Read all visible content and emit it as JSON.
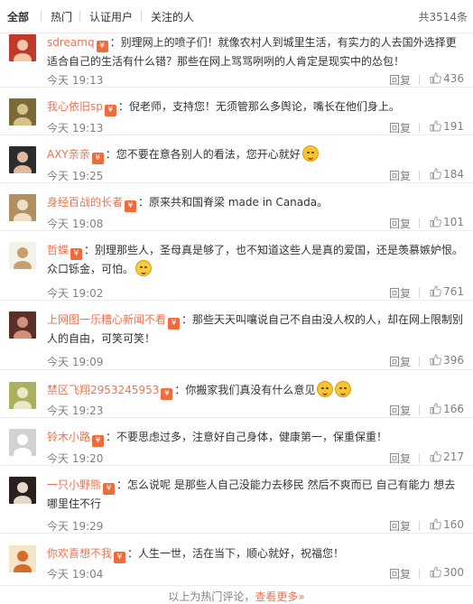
{
  "tabs": [
    "全部",
    "热门",
    "认证用户",
    "关注的人"
  ],
  "total": "共3514条",
  "vip_label": "¥",
  "reply_label": "回复",
  "colors": {
    "name": "#eb7350",
    "vip": "#f06a3a",
    "muted": "#808080"
  },
  "comments": [
    {
      "user": "sdreamq",
      "text": "：别理网上的喷子们！就像农村人到城里生活，有实力的人去国外选择更适合自己的生活有什么错？那些在网上骂骂咧咧的人肯定是现实中的怂包！",
      "time": "今天 19:13",
      "likes": "436",
      "emoji": 0
    },
    {
      "user": "我心依旧sp",
      "text": "：倪老师，支持您！无须管那么多舆论，嘴长在他们身上。",
      "time": "今天 19:13",
      "likes": "191",
      "emoji": 0
    },
    {
      "user": "AXY亲亲",
      "text": "：您不要在意各别人的看法，您开心就好",
      "time": "今天 19:25",
      "likes": "184",
      "emoji": 1
    },
    {
      "user": "身经百战的长者",
      "text": "：原来共和国脊梁 made in Canada。",
      "time": "今天 19:08",
      "likes": "101",
      "emoji": 0
    },
    {
      "user": "哲蝶",
      "text": "：别理那些人，圣母真是够了，也不知道这些人是真的爱国，还是羡慕嫉妒恨。众口铄金，可怕。",
      "time": "今天 19:02",
      "likes": "761",
      "emoji": 1
    },
    {
      "user": "上网图一乐糟心新闻不看",
      "text": "：那些天天叫嚷说自己不自由没人权的人，却在网上限制别人的自由，可笑可笑！",
      "time": "今天 19:09",
      "likes": "396",
      "emoji": 0
    },
    {
      "user": "禁区飞翔2953245953",
      "text": "：你搬家我们真没有什么意见",
      "time": "今天 19:23",
      "likes": "166",
      "emoji": 2
    },
    {
      "user": "铃木小路",
      "text": "：不要思虑过多，注意好自己身体，健康第一，保重保重！",
      "time": "今天 19:20",
      "likes": "217",
      "emoji": 0
    },
    {
      "user": "一只小野熊",
      "text": "：怎么说呢 是那些人自己没能力去移民 然后不爽而已 自己有能力 想去哪里住不行",
      "time": "今天 19:29",
      "likes": "160",
      "emoji": 0
    },
    {
      "user": "你欢喜想不我",
      "text": "：人生一世，活在当下，顺心就好，祝福您！",
      "time": "今天 19:04",
      "likes": "300",
      "emoji": 0
    }
  ],
  "footer": {
    "prefix": "以上为热门评论，",
    "more": "查看更多»"
  }
}
